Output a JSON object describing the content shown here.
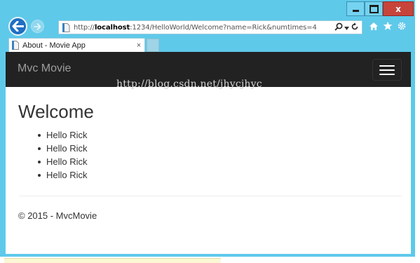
{
  "browser": {
    "address": {
      "prefix": "http://",
      "host": "localhost",
      "rest": ":1234/HelloWorld/Welcome?name=Rick&numtimes=4"
    },
    "tab": {
      "title": "About - Movie App",
      "close_glyph": "×"
    },
    "window_controls": {
      "close_glyph": "x"
    }
  },
  "page": {
    "brand": "Mvc Movie",
    "heading": "Welcome",
    "greetings": [
      "Hello Rick",
      "Hello Rick",
      "Hello Rick",
      "Hello Rick"
    ],
    "footer": "© 2015 - MvcMovie",
    "watermark": "http://blog.csdn.net/jhycjhyc"
  },
  "colors": {
    "window_frame": "#5fc9ea",
    "navbar": "#222222",
    "brand_text": "#9d9d9d",
    "back_button": "#1f6fc4",
    "close_button": "#c7443a"
  },
  "icons": [
    "back-arrow-icon",
    "forward-arrow-icon",
    "page-icon",
    "search-icon",
    "dropdown-arrow-icon",
    "refresh-icon",
    "home-icon",
    "favorites-star-icon",
    "settings-gear-icon",
    "hamburger-menu-icon"
  ]
}
